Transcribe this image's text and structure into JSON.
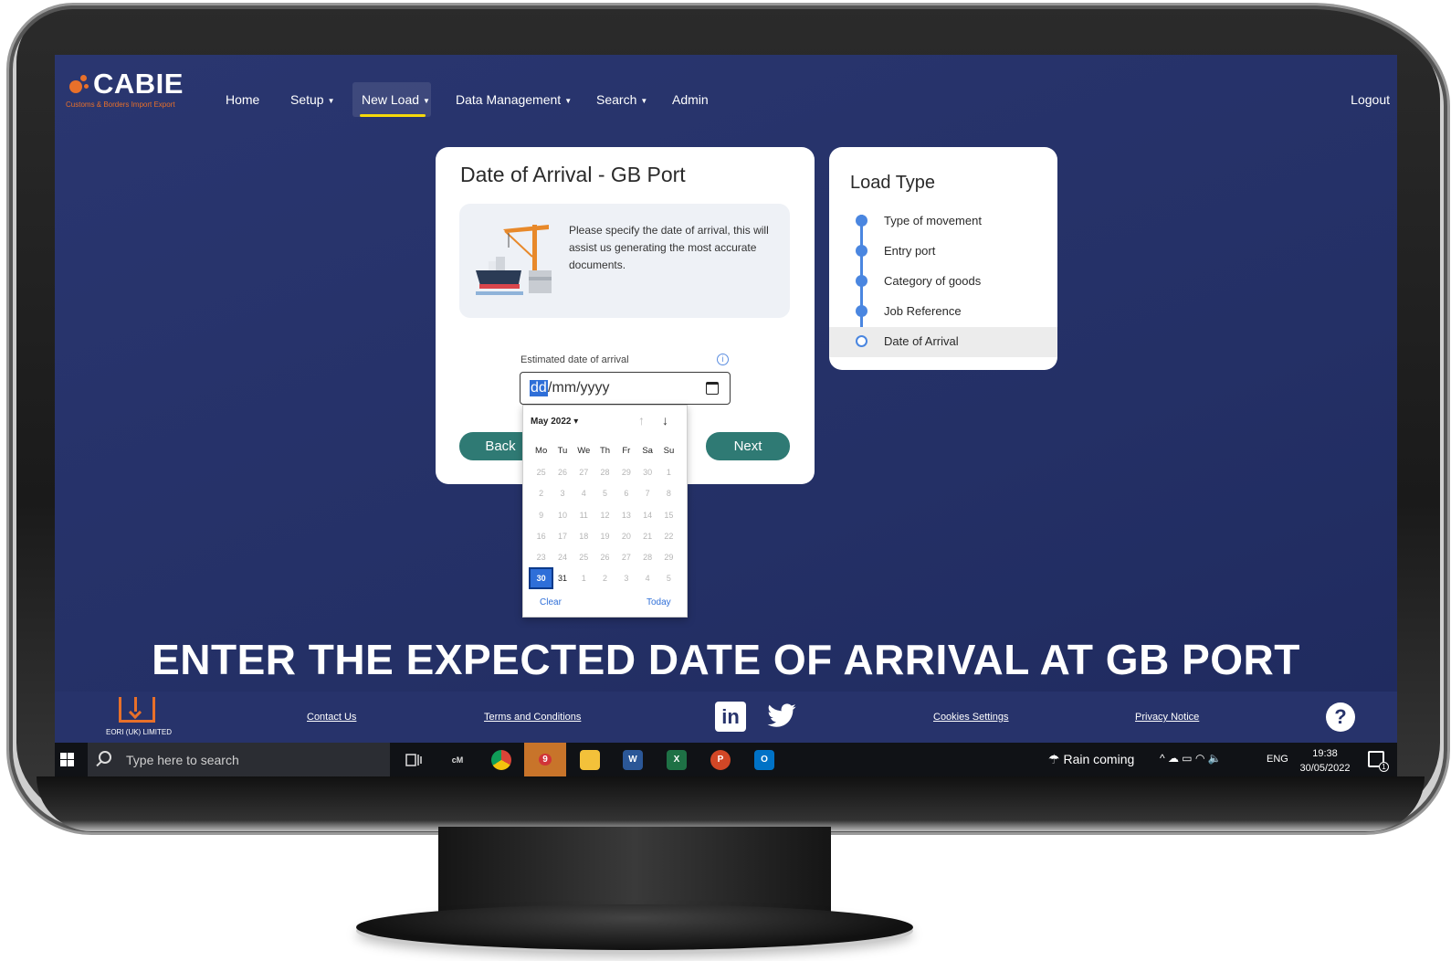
{
  "app": {
    "logo_text": "CABIE",
    "logo_subtitle": "Customs & Borders Import Export"
  },
  "nav": {
    "home": "Home",
    "setup": "Setup",
    "new_load": "New Load",
    "data_management": "Data Management",
    "search": "Search",
    "admin": "Admin",
    "logout": "Logout",
    "caret": "▼",
    "active_item": "New Load",
    "active_underline_color": "#f5d90a"
  },
  "form": {
    "title": "Date of Arrival - GB Port",
    "info_text": "Please specify the date of arrival, this will assist us generating the most accurate documents.",
    "field_label": "Estimated date of arrival",
    "info_icon": "i",
    "date_segment_dd": "dd",
    "date_segment_rest": "/mm/yyyy",
    "back_label": "Back",
    "next_label": "Next",
    "button_color": "#2f7a74"
  },
  "calendar": {
    "month_label": "May 2022 ▾",
    "up_arrow": "↑",
    "down_arrow": "↓",
    "weekdays": [
      "Mo",
      "Tu",
      "We",
      "Th",
      "Fr",
      "Sa",
      "Su"
    ],
    "weeks": [
      [
        "25",
        "26",
        "27",
        "28",
        "29",
        "30",
        "1"
      ],
      [
        "2",
        "3",
        "4",
        "5",
        "6",
        "7",
        "8"
      ],
      [
        "9",
        "10",
        "11",
        "12",
        "13",
        "14",
        "15"
      ],
      [
        "16",
        "17",
        "18",
        "19",
        "20",
        "21",
        "22"
      ],
      [
        "23",
        "24",
        "25",
        "26",
        "27",
        "28",
        "29"
      ],
      [
        "30",
        "31",
        "1",
        "2",
        "3",
        "4",
        "5"
      ]
    ],
    "selected_day": "30",
    "clear_label": "Clear",
    "today_label": "Today",
    "accent_color": "#2f6fd8"
  },
  "steps": {
    "title": "Load Type",
    "items": [
      {
        "label": "Type of movement",
        "done": true
      },
      {
        "label": "Entry port",
        "done": true
      },
      {
        "label": "Category of goods",
        "done": true
      },
      {
        "label": "Job Reference",
        "done": true
      },
      {
        "label": "Date of Arrival",
        "done": false,
        "active": true
      }
    ],
    "line_color": "#4a86e0"
  },
  "headline": "ENTER THE EXPECTED DATE OF ARRIVAL AT GB PORT",
  "footer": {
    "company": "EORI (UK) LIMITED",
    "contact": "Contact Us",
    "terms": "Terms and Conditions",
    "linkedin": "in",
    "cookies": "Cookies Settings",
    "privacy": "Privacy Notice",
    "help": "?"
  },
  "taskbar": {
    "search_placeholder": "Type here to search",
    "cm_label": "cM",
    "teams_badge": "9",
    "word_label": "W",
    "excel_label": "X",
    "powerpoint_label": "P",
    "outlook_label": "O",
    "weather": "Rain coming",
    "tray_icons": "^ ☁ ▭ ◠ 🔈",
    "lang": "ENG",
    "time": "19:38",
    "date": "30/05/2022",
    "notif_count": "1"
  }
}
